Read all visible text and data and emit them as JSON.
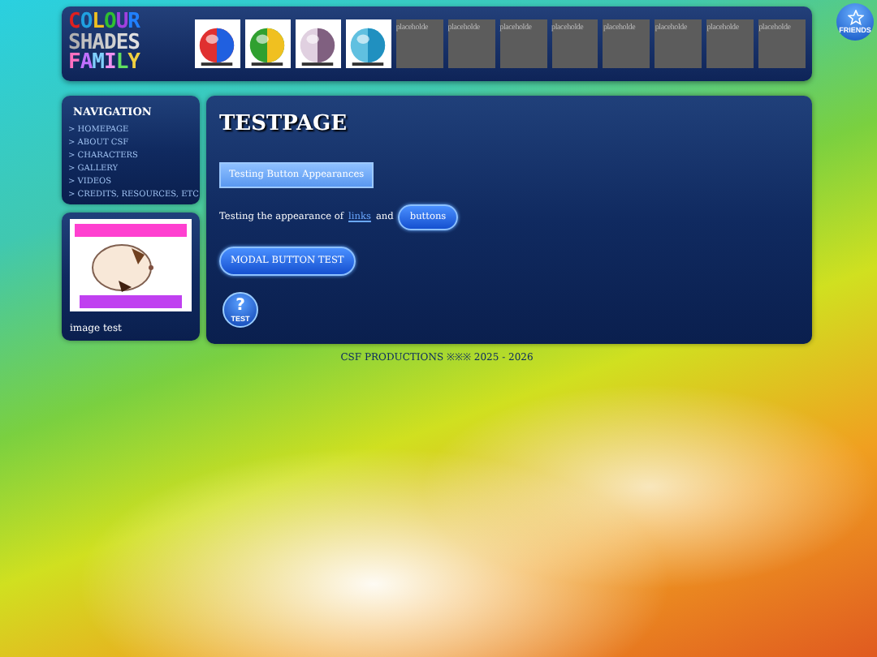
{
  "header": {
    "logo": [
      "COLOUR",
      "SHADES",
      "FAMILY"
    ],
    "thumbnails": [
      {
        "kind": "picture"
      },
      {
        "kind": "picture"
      },
      {
        "kind": "picture"
      },
      {
        "kind": "picture"
      }
    ],
    "placeholders": [
      "placeholde",
      "placeholde",
      "placeholde",
      "placeholde",
      "placeholde",
      "placeholde",
      "placeholde",
      "placeholde"
    ]
  },
  "friends_button": {
    "label": "FRIENDS"
  },
  "navigation": {
    "title": "NAVIGATION",
    "items": [
      "> HOMEPAGE",
      "> ABOUT CSF",
      "> CHARACTERS",
      "> GALLERY",
      "> VIDEOS",
      "> CREDITS, RESOURCES, ETC"
    ]
  },
  "image_card": {
    "caption": "image test"
  },
  "main": {
    "title": "TESTPAGE",
    "square_button": "Testing Button Appearances",
    "sentence_before": "Testing the appearance of",
    "link": "links",
    "sentence_middle": "and",
    "pill_button": "buttons",
    "modal_button": "MODAL BUTTON TEST",
    "help_button": {
      "symbol": "?",
      "label": "TEST"
    }
  },
  "footer": "CSF PRODUCTIONS ※※※ 2025 - 2026"
}
